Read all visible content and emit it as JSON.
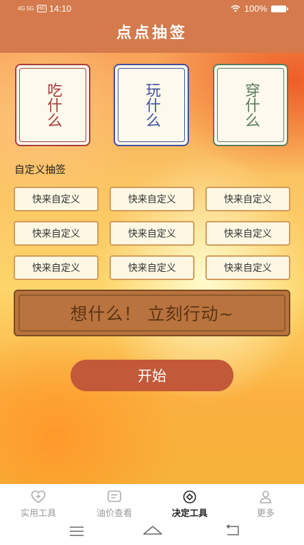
{
  "status_bar": {
    "network": "4G 5G",
    "hd": "HD",
    "time": "14:10",
    "battery": "100%"
  },
  "header": {
    "title": "点点抽签"
  },
  "cards": [
    {
      "label": "吃什么",
      "color": "#a73b38"
    },
    {
      "label": "玩什么",
      "color": "#3d4f9e"
    },
    {
      "label": "穿什么",
      "color": "#587a5a"
    }
  ],
  "custom": {
    "section_label": "自定义抽签",
    "buttons": [
      "快来自定义",
      "快来自定义",
      "快来自定义",
      "快来自定义",
      "快来自定义",
      "快来自定义",
      "快来自定义",
      "快来自定义",
      "快来自定义"
    ]
  },
  "banner": {
    "text": "想什么！ 立刻行动~"
  },
  "start_button": {
    "label": "开始"
  },
  "bottom_nav": {
    "items": [
      {
        "label": "实用工具",
        "icon": "heart-plus-icon",
        "active": false
      },
      {
        "label": "油价查看",
        "icon": "chat-box-icon",
        "active": false
      },
      {
        "label": "决定工具",
        "icon": "eye-diamond-icon",
        "active": true
      },
      {
        "label": "更多",
        "icon": "person-icon",
        "active": false
      }
    ]
  }
}
